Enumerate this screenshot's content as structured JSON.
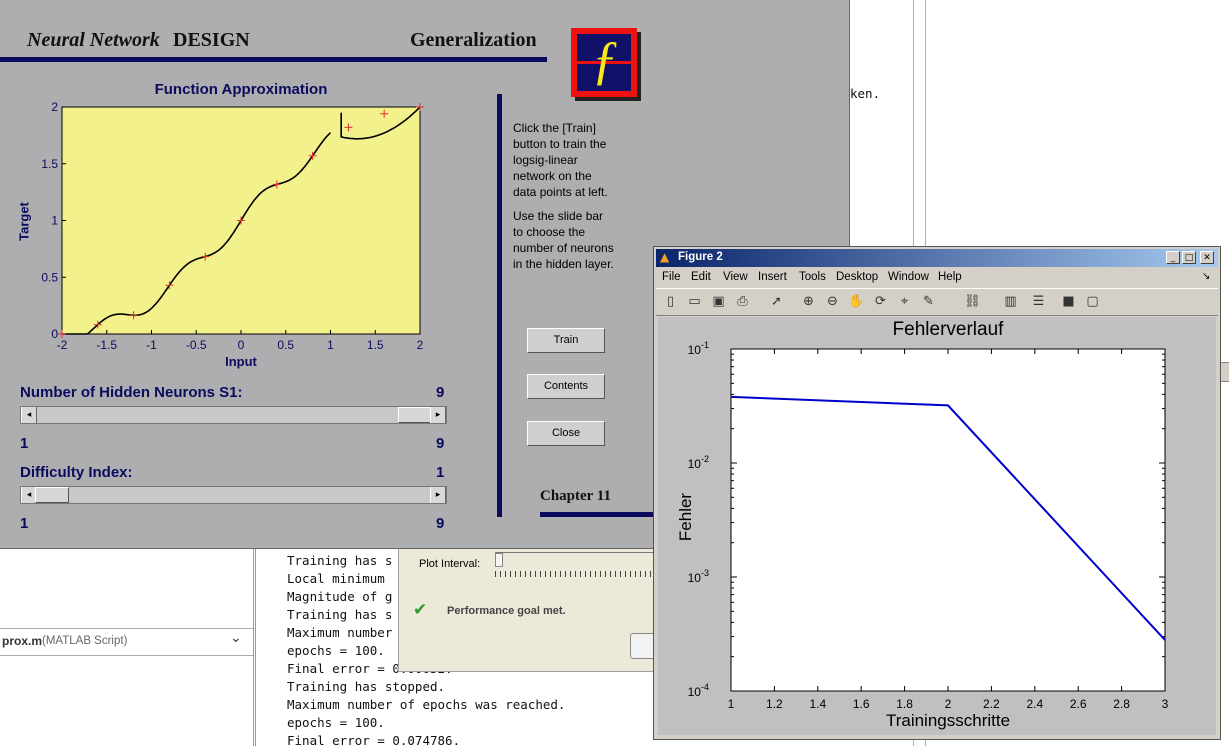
{
  "nnd": {
    "brand_italic": "Neural Network",
    "brand_bold": "DESIGN",
    "chapter_title": "Generalization",
    "logo_glyph": "ƒ",
    "plot": {
      "title": "Function Approximation",
      "xlabel": "Input",
      "ylabel": "Target",
      "xticks": [
        "-2",
        "-1.5",
        "-1",
        "-0.5",
        "0",
        "0.5",
        "1",
        "1.5",
        "2"
      ],
      "yticks": [
        "0",
        "0.5",
        "1",
        "1.5",
        "2"
      ],
      "bg_color": "#f3f18c",
      "curve_color": "#000000",
      "marker_color": "#e03030"
    },
    "instructions_1": [
      "Click the [Train]",
      "button to train the",
      "logsig-linear",
      "network on the",
      "data points at left."
    ],
    "instructions_2": [
      "Use the slide bar",
      "to choose the",
      "number of neurons",
      "in the hidden layer."
    ],
    "buttons": {
      "train": "Train",
      "contents": "Contents",
      "close": "Close"
    },
    "neurons_label": "Number of Hidden Neurons S1:",
    "neurons_value": "9",
    "neurons_min": "1",
    "neurons_max": "9",
    "neurons_fraction": 1.0,
    "difficulty_label": "Difficulty Index:",
    "difficulty_value": "1",
    "difficulty_min": "1",
    "difficulty_max": "9",
    "difficulty_fraction": 0.0,
    "chapter": "Chapter 11"
  },
  "editor": {
    "file": "prox.m",
    "type": "(MATLAB Script)"
  },
  "desk_text": "ken.",
  "command_lines": [
    "Training has s",
    "Local minimum ",
    "Magnitude of g",
    "Training has s",
    "Maximum number",
    "epochs = 100.",
    "Final error = 0.00052.",
    "Training has stopped.",
    "Maximum number of epochs was reached.",
    "epochs = 100.",
    "Final error = 0.074786."
  ],
  "nntool": {
    "plot_interval": "Plot Interval:",
    "status": "Performance goal met."
  },
  "figure2": {
    "title": "Figure 2",
    "menu": [
      "File",
      "Edit",
      "View",
      "Insert",
      "Tools",
      "Desktop",
      "Window",
      "Help"
    ],
    "toolbar_icons": [
      "new-file-icon",
      "open-folder-icon",
      "save-icon",
      "print-icon",
      "pointer-icon",
      "zoom-in-icon",
      "zoom-out-icon",
      "pan-icon",
      "rotate-icon",
      "data-cursor-icon",
      "brush-icon",
      "link-icon",
      "colorbar-icon",
      "legend-icon",
      "hide-tools-icon",
      "show-tools-icon"
    ],
    "chart_title": "Fehlerverlauf",
    "xlabel": "Trainingsschritte",
    "ylabel": "Fehler",
    "line_color": "#0000cc"
  },
  "chart_data": {
    "type": "line",
    "title": "Fehlerverlauf",
    "xlabel": "Trainingsschritte",
    "ylabel": "Fehler",
    "x": [
      1,
      2,
      3
    ],
    "y": [
      0.038,
      0.032,
      0.00028
    ],
    "xlim": [
      1,
      3
    ],
    "ylim": [
      0.0001,
      0.1
    ],
    "yscale": "log",
    "xticks": [
      "1",
      "1.2",
      "1.4",
      "1.6",
      "1.8",
      "2",
      "2.2",
      "2.4",
      "2.6",
      "2.8",
      "3"
    ],
    "yticks": [
      {
        "base": "10",
        "exp": "-4"
      },
      {
        "base": "10",
        "exp": "-3"
      },
      {
        "base": "10",
        "exp": "-2"
      },
      {
        "base": "10",
        "exp": "-1"
      }
    ],
    "grid": false
  }
}
